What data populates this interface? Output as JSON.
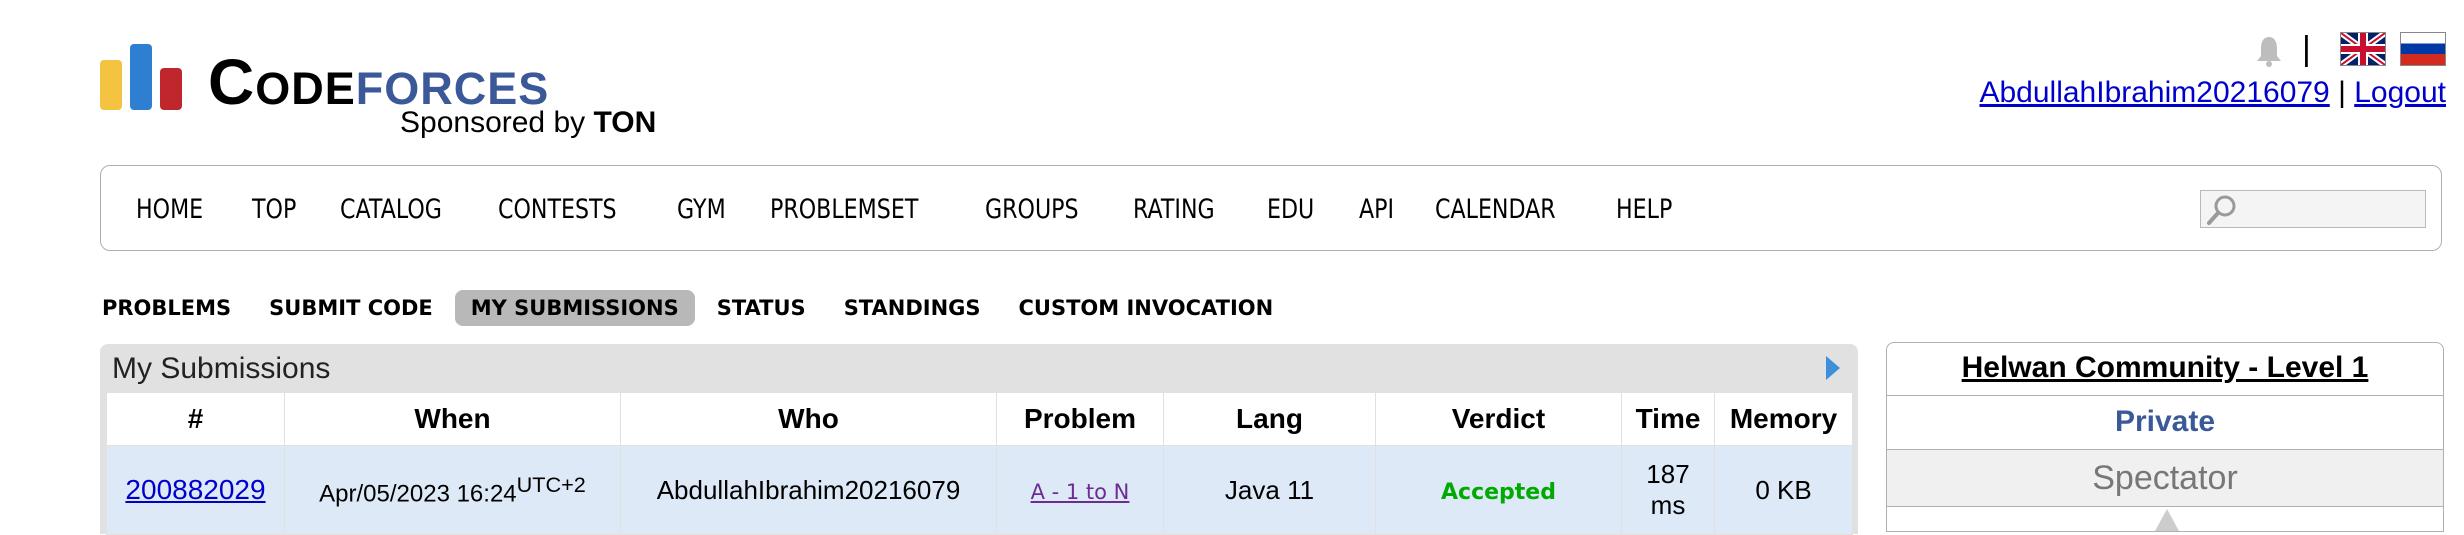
{
  "brand": {
    "logo_code": "Code",
    "logo_forces": "forces",
    "sponsor_prefix": "Sponsored by",
    "sponsor_name": "TON",
    "bar_colors": [
      "#f5c342",
      "#2e7fd1",
      "#c0272d"
    ]
  },
  "header": {
    "separator": "|",
    "username": "AbdullahIbrahim20216079",
    "logout": "Logout",
    "icons": [
      "bell-icon",
      "uk-flag-icon",
      "russia-flag-icon"
    ]
  },
  "nav": {
    "items": [
      "HOME",
      "TOP",
      "CATALOG",
      "CONTESTS",
      "GYM",
      "PROBLEMSET",
      "GROUPS",
      "RATING",
      "EDU",
      "API",
      "CALENDAR",
      "HELP"
    ]
  },
  "subnav": {
    "items": [
      "PROBLEMS",
      "SUBMIT CODE",
      "MY SUBMISSIONS",
      "STATUS",
      "STANDINGS",
      "CUSTOM INVOCATION"
    ],
    "active": "MY SUBMISSIONS"
  },
  "submissions": {
    "title": "My Submissions",
    "columns": [
      "#",
      "When",
      "Who",
      "Problem",
      "Lang",
      "Verdict",
      "Time",
      "Memory"
    ],
    "rows": [
      {
        "id": "200882029",
        "when": "Apr/05/2023 16:24",
        "tz": "UTC+2",
        "who": "AbdullahIbrahim20216079",
        "problem": "A - 1 to N",
        "lang": "Java 11",
        "verdict": "Accepted",
        "time_value": "187",
        "time_unit": "ms",
        "memory": "0 KB"
      }
    ]
  },
  "sidebar": {
    "contest_name": "Helwan Community - Level 1",
    "visibility": "Private",
    "role": "Spectator"
  },
  "colors": {
    "link": "#0000cc",
    "brand_blue": "#3b5998",
    "accepted": "#00aa00",
    "row_bg": "#dde9f6",
    "active_tab_bg": "#b8b8b8"
  }
}
